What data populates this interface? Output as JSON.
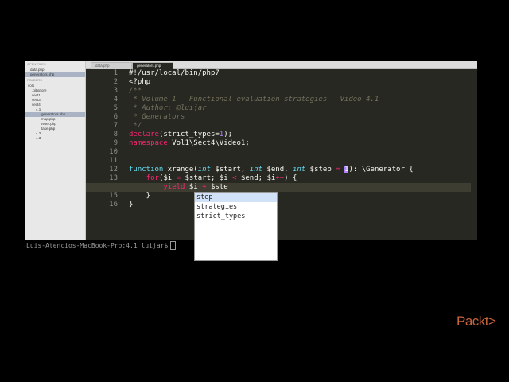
{
  "sidebar": {
    "open_files_header": "OPEN FILES",
    "open_files": [
      "data.php",
      "generators.php"
    ],
    "folders_header": "FOLDERS",
    "tree": [
      "vol1",
      ".gitignore",
      "sect1",
      "sect3",
      "sect4",
      "4.1",
      "generators.php",
      "map.php",
      "reset.php",
      "take.php",
      "4.2",
      "4.3"
    ]
  },
  "tabs": [
    "data.php",
    "generators.php"
  ],
  "editor": {
    "line_numbers": [
      "1",
      "2",
      "3",
      "4",
      "5",
      "6",
      "7",
      "8",
      "9",
      "10",
      "11",
      "12",
      "13",
      "14",
      "15",
      "16"
    ],
    "current_line": "14"
  },
  "code": {
    "l1": "#!/usr/local/bin/php7",
    "l2": "<?php",
    "l3": "/**",
    "l4": " * Volume 1 – Functional evaluation strategies – Video 4.1",
    "l5": " * Author: @luijar",
    "l6": " * Generators",
    "l7": " */",
    "l8_fn": "declare",
    "l8_rest": "(strict_types=",
    "l8_num": "1",
    "l8_end": ");",
    "l9_kw": "namespace",
    "l9_rest": " Vol1\\Sect4\\Video1;",
    "l12_fn": "function",
    "l12_name": " xrange(",
    "l12_t1": "int",
    "l12_v1": " $start, ",
    "l12_t2": "int",
    "l12_v2": " $end, ",
    "l12_t3": "int",
    "l12_v3": " $step ",
    "l12_eq": "=",
    "l12_sp": " ",
    "l12_num": "1",
    "l12_end": "): \\Generator {",
    "l13_indent": "    ",
    "l13_kw": "for",
    "l13_a": "($i ",
    "l13_eq": "=",
    "l13_b": " $start; $i ",
    "l13_lt": "<",
    "l13_c": " $end; $i",
    "l13_pp": "++",
    "l13_d": ") {",
    "l14_indent": "        ",
    "l14_kw": "yield",
    "l14_a": " $i ",
    "l14_op": "+",
    "l14_b": " $ste",
    "l15": "    }",
    "l16": "}"
  },
  "autocomplete": {
    "items": [
      "step",
      "strategies",
      "strict_types"
    ]
  },
  "terminal": {
    "prompt": "Luis-Atencios-MacBook-Pro:4.1 luijar$"
  },
  "logo": {
    "text": "Packt>"
  },
  "colors": {
    "editor_bg": "#272822",
    "comment": "#75715e",
    "keyword": "#f92672",
    "function": "#66d9ef",
    "number": "#ae81ff",
    "logo": "#c9643b"
  }
}
